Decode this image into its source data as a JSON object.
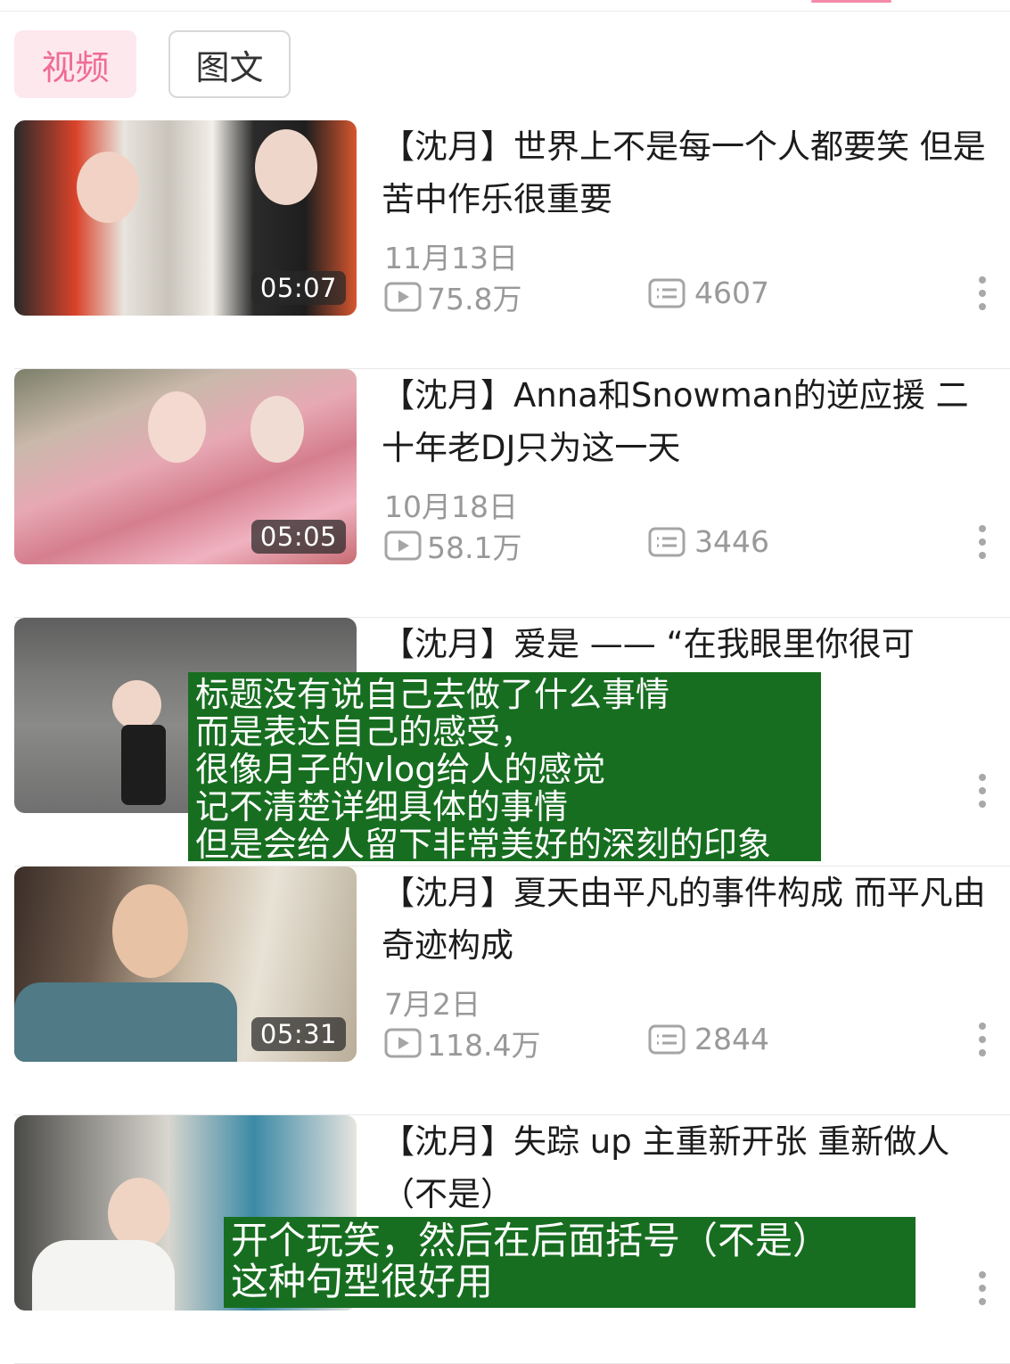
{
  "tabs": [
    {
      "label": "视频",
      "active": true
    },
    {
      "label": "图文",
      "active": false
    }
  ],
  "videos": [
    {
      "title": "【沈月】世界上不是每一个人都要笑 但是苦中作乐很重要",
      "date": "11月13日",
      "views": "75.8万",
      "comments": "4607",
      "duration": "05:07"
    },
    {
      "title": "【沈月】Anna和Snowman的逆应援 二十年老DJ只为这一天",
      "date": "10月18日",
      "views": "58.1万",
      "comments": "3446",
      "duration": "05:05"
    },
    {
      "title": "【沈月】爱是 —— “在我眼里你很可",
      "date": "",
      "views": "",
      "comments": "",
      "duration": ""
    },
    {
      "title": "【沈月】夏天由平凡的事件构成 而平凡由奇迹构成",
      "date": "7月2日",
      "views": "118.4万",
      "comments": "2844",
      "duration": "05:31"
    },
    {
      "title": "【沈月】失踪 up 主重新开张 重新做人（不是）",
      "date": "",
      "views": "",
      "comments": "",
      "duration": ""
    }
  ],
  "annotations": {
    "note1": [
      "标题没有说自己去做了什么事情",
      "而是表达自己的感受，",
      "很像月子的vlog给人的感觉",
      "记不清楚详细具体的事情",
      "但是会给人留下非常美好的深刻的印象"
    ],
    "note2": [
      "开个玩笑，然后在后面括号（不是）",
      "这种句型很好用"
    ]
  },
  "colors": {
    "accent": "#ef6c95",
    "annotation_bg": "#176e20",
    "meta_gray": "#999999"
  },
  "icons": {
    "views": "play-icon",
    "comments": "comment-icon",
    "more": "more-vertical-icon"
  }
}
